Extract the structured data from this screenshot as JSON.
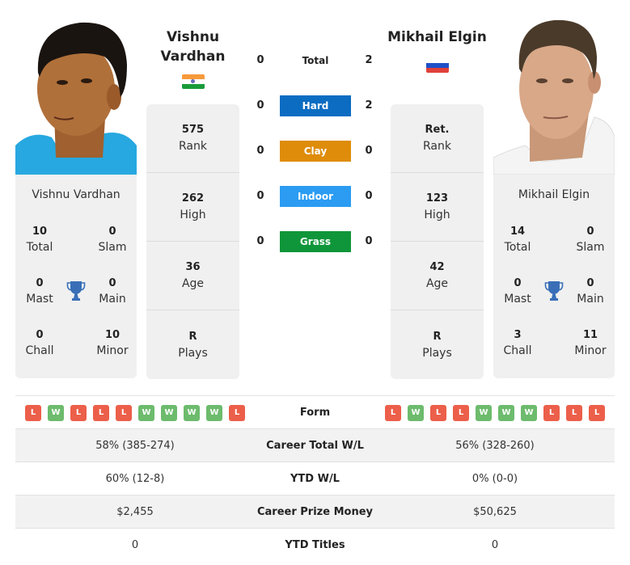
{
  "players": {
    "left": {
      "name": "Vishnu Vardhan",
      "name_line1": "Vishnu",
      "name_line2": "Vardhan",
      "flag": {
        "country": "India",
        "icon": "india-flag-icon",
        "colors": [
          "#f79a3a",
          "#ffffff",
          "#1a9b3a"
        ]
      },
      "photo_icon": "player-photo",
      "titles": {
        "total": {
          "value": "10",
          "label": "Total"
        },
        "slam": {
          "value": "0",
          "label": "Slam"
        },
        "mast": {
          "value": "0",
          "label": "Mast"
        },
        "main": {
          "value": "0",
          "label": "Main"
        },
        "chall": {
          "value": "0",
          "label": "Chall"
        },
        "minor": {
          "value": "10",
          "label": "Minor"
        }
      },
      "stats": [
        {
          "value": "575",
          "label": "Rank"
        },
        {
          "value": "262",
          "label": "High"
        },
        {
          "value": "36",
          "label": "Age"
        },
        {
          "value": "R",
          "label": "Plays"
        }
      ],
      "form": [
        "L",
        "W",
        "L",
        "L",
        "L",
        "W",
        "W",
        "W",
        "W",
        "L"
      ]
    },
    "right": {
      "name": "Mikhail Elgin",
      "flag": {
        "country": "Russia",
        "icon": "russia-flag-icon",
        "colors": [
          "#ffffff",
          "#2050c8",
          "#e0403a"
        ]
      },
      "photo_icon": "player-photo",
      "titles": {
        "total": {
          "value": "14",
          "label": "Total"
        },
        "slam": {
          "value": "0",
          "label": "Slam"
        },
        "mast": {
          "value": "0",
          "label": "Mast"
        },
        "main": {
          "value": "0",
          "label": "Main"
        },
        "chall": {
          "value": "3",
          "label": "Chall"
        },
        "minor": {
          "value": "11",
          "label": "Minor"
        }
      },
      "stats": [
        {
          "value": "Ret.",
          "label": "Rank"
        },
        {
          "value": "123",
          "label": "High"
        },
        {
          "value": "42",
          "label": "Age"
        },
        {
          "value": "R",
          "label": "Plays"
        }
      ],
      "form": [
        "L",
        "W",
        "L",
        "L",
        "W",
        "W",
        "W",
        "L",
        "L",
        "L"
      ]
    }
  },
  "h2h": [
    {
      "label": "Total",
      "left": "0",
      "right": "2",
      "color": ""
    },
    {
      "label": "Hard",
      "left": "0",
      "right": "2",
      "color": "#0b6cc2"
    },
    {
      "label": "Clay",
      "left": "0",
      "right": "0",
      "color": "#de8c0a"
    },
    {
      "label": "Indoor",
      "left": "0",
      "right": "0",
      "color": "#2b9cf2"
    },
    {
      "label": "Grass",
      "left": "0",
      "right": "0",
      "color": "#10963a"
    }
  ],
  "comparison": {
    "form_label": "Form",
    "rows": [
      {
        "label": "Career Total W/L",
        "left": "58% (385-274)",
        "right": "56% (328-260)"
      },
      {
        "label": "YTD W/L",
        "left": "60% (12-8)",
        "right": "0% (0-0)"
      },
      {
        "label": "Career Prize Money",
        "left": "$2,455",
        "right": "$50,625"
      },
      {
        "label": "YTD Titles",
        "left": "0",
        "right": "0"
      }
    ]
  },
  "colors": {
    "trophy": "#3a6fb8",
    "win": "#6dbb6d",
    "loss": "#ec5f4a",
    "card_bg": "#f0f0f0"
  }
}
